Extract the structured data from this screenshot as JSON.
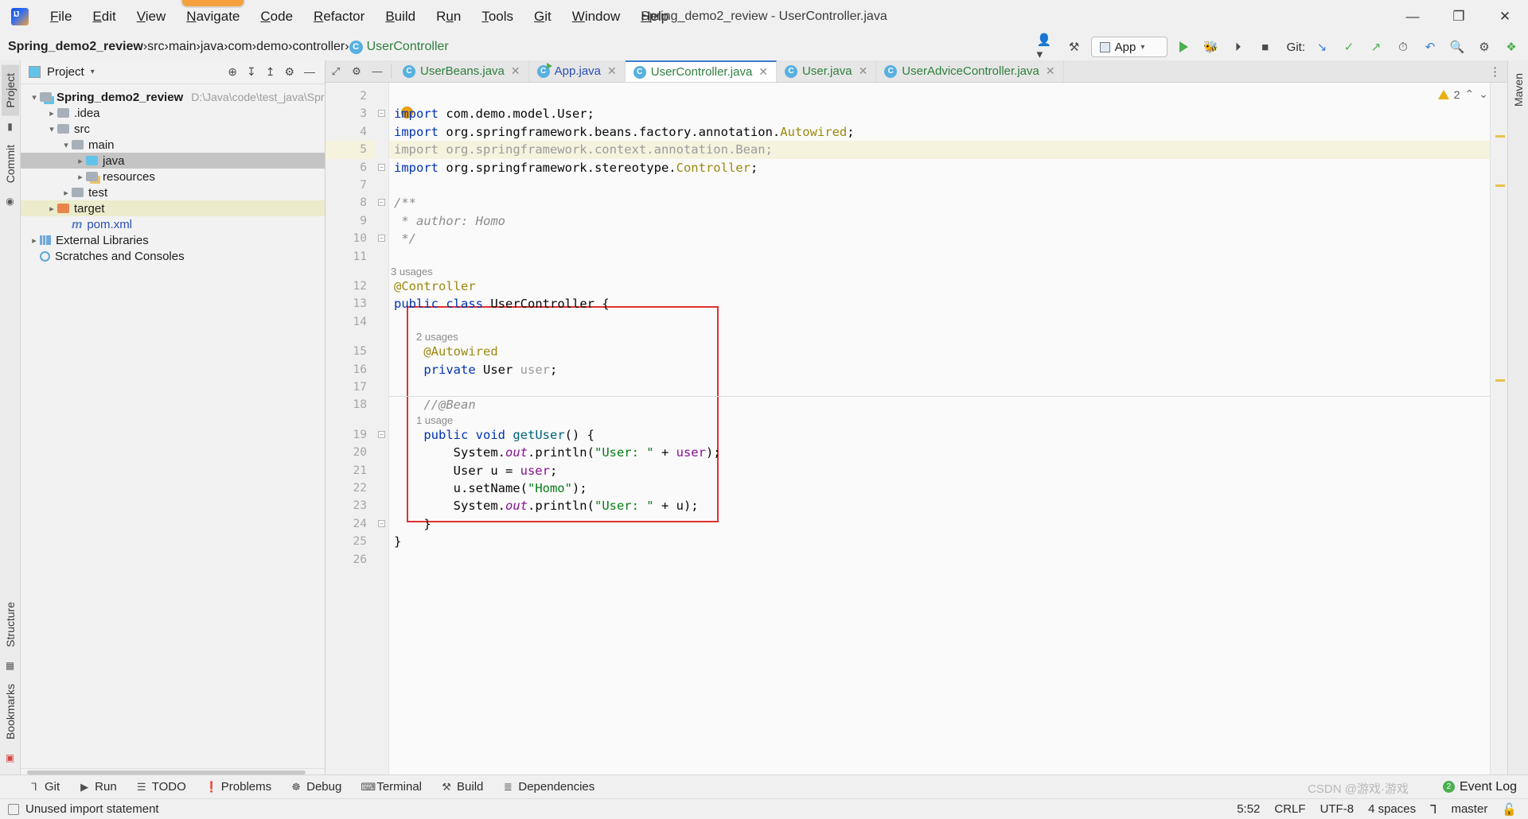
{
  "window": {
    "title": "Spring_demo2_review - UserController.java",
    "app_icon": "intellij-idea-logo",
    "minimize": "—",
    "maximize": "❐",
    "close": "✕"
  },
  "menu": {
    "items": [
      {
        "label": "File",
        "mnemonic": "F"
      },
      {
        "label": "Edit",
        "mnemonic": "E"
      },
      {
        "label": "View",
        "mnemonic": "V"
      },
      {
        "label": "Navigate",
        "mnemonic": "N",
        "highlighted": true
      },
      {
        "label": "Code",
        "mnemonic": "C"
      },
      {
        "label": "Refactor",
        "mnemonic": "R"
      },
      {
        "label": "Build",
        "mnemonic": "B"
      },
      {
        "label": "Run",
        "mnemonic": "u"
      },
      {
        "label": "Tools",
        "mnemonic": "T"
      },
      {
        "label": "Git",
        "mnemonic": "G"
      },
      {
        "label": "Window",
        "mnemonic": "W"
      },
      {
        "label": "Help",
        "mnemonic": "H"
      }
    ]
  },
  "navbar": {
    "crumbs": [
      "Spring_demo2_review",
      "src",
      "main",
      "java",
      "com",
      "demo",
      "controller"
    ],
    "final_crumb": "UserController",
    "final_crumb_icon": "class-icon",
    "separator": "›",
    "right": {
      "profile_icon": "user-account-icon",
      "hammer_icon": "build-hammer-icon",
      "run_config": "App",
      "run_icon": "run-play-icon",
      "debug_icon": "debug-bug-icon",
      "coverage_icon": "run-with-coverage-icon",
      "stop_icon": "stop-icon",
      "git_label": "Git:",
      "git_update_icon": "git-update-icon",
      "git_commit_icon": "git-commit-check-icon",
      "git_push_icon": "git-push-icon",
      "history_icon": "history-icon",
      "undo_icon": "undo-icon",
      "search_icon": "search-icon",
      "settings_icon": "gear-icon",
      "ide_icon": "ide-update-icon"
    }
  },
  "left_rail": {
    "tabs": [
      "Project",
      "Commit"
    ],
    "bottom_tabs": [
      "Structure",
      "Bookmarks"
    ],
    "active": "Project"
  },
  "right_rail": {
    "tabs": [
      "Maven"
    ]
  },
  "project_panel": {
    "title": "Project",
    "title_icon": "project-view-icon",
    "dropdown_icon": "chevron-down-icon",
    "actions": [
      {
        "name": "select-opened-file-icon",
        "glyph": "⊕"
      },
      {
        "name": "expand-all-icon",
        "glyph": "↧"
      },
      {
        "name": "collapse-all-icon",
        "glyph": "↥"
      },
      {
        "name": "settings-icon",
        "glyph": "⚙"
      },
      {
        "name": "hide-icon",
        "glyph": "—"
      }
    ],
    "tree": [
      {
        "label": "Spring_demo2_review",
        "path": "D:\\Java\\code\\test_java\\Spring_deme",
        "depth": 0,
        "arrow": "expanded",
        "icon": "module-folder",
        "bold": true
      },
      {
        "label": ".idea",
        "depth": 1,
        "arrow": "collapsed",
        "icon": "folder"
      },
      {
        "label": "src",
        "depth": 1,
        "arrow": "expanded",
        "icon": "folder"
      },
      {
        "label": "main",
        "depth": 2,
        "arrow": "expanded",
        "icon": "folder"
      },
      {
        "label": "java",
        "depth": 3,
        "arrow": "collapsed",
        "icon": "source-folder",
        "selected": true
      },
      {
        "label": "resources",
        "depth": 3,
        "arrow": "collapsed",
        "icon": "resource-folder"
      },
      {
        "label": "test",
        "depth": 2,
        "arrow": "collapsed",
        "icon": "folder"
      },
      {
        "label": "target",
        "depth": 1,
        "arrow": "collapsed",
        "icon": "excluded-folder",
        "highlighted": true
      },
      {
        "label": "pom.xml",
        "depth": 2,
        "arrow": "none",
        "icon": "maven-icon"
      },
      {
        "label": "External Libraries",
        "depth": 0,
        "arrow": "collapsed",
        "icon": "libraries-icon"
      },
      {
        "label": "Scratches and Consoles",
        "depth": 0,
        "arrow": "none",
        "icon": "scratches-icon"
      }
    ]
  },
  "editor": {
    "tab_icons": [
      {
        "name": "collapse-icon",
        "glyph": "⤢"
      },
      {
        "name": "gear-icon",
        "glyph": "⚙"
      },
      {
        "name": "hide-icon",
        "glyph": "—"
      }
    ],
    "tabs": [
      {
        "label": "UserBeans.java",
        "icon": "class-icon",
        "active": false,
        "color": "green"
      },
      {
        "label": "App.java",
        "icon": "runnable-class-icon",
        "active": false,
        "color": "blue"
      },
      {
        "label": "UserController.java",
        "icon": "class-icon",
        "active": true,
        "color": "green"
      },
      {
        "label": "User.java",
        "icon": "class-icon",
        "active": false,
        "color": "green"
      },
      {
        "label": "UserAdviceController.java",
        "icon": "class-icon",
        "active": false,
        "color": "green"
      }
    ],
    "close_glyph": "✕",
    "more_glyph": "⋮",
    "warning_count": "2",
    "warning_icon": "warning-triangle-icon",
    "inspection_up": "⌃",
    "inspection_down": "⌄",
    "annotation_box": "red-highlight-box",
    "annotation_color": "#e03131"
  },
  "code": {
    "first_visible_line": 2,
    "last_visible_line": 26,
    "hints": [
      {
        "line": 12,
        "text": "3 usages"
      },
      {
        "line": 15,
        "text": "2 usages"
      },
      {
        "line": 19,
        "text": "1 usage"
      }
    ],
    "lines": [
      {
        "n": 2,
        "tokens": []
      },
      {
        "n": 3,
        "tokens": [
          {
            "t": "import",
            "c": "kw"
          },
          {
            "t": " com.demo.model.User;",
            "c": "plain"
          }
        ]
      },
      {
        "n": 4,
        "tokens": [
          {
            "t": "import",
            "c": "kw"
          },
          {
            "t": " org.springframework.beans.factory.annotation.",
            "c": "plain"
          },
          {
            "t": "Autowired",
            "c": "ann"
          },
          {
            "t": ";",
            "c": "plain"
          }
        ]
      },
      {
        "n": 5,
        "tokens": [
          {
            "t": "import",
            "c": "gray"
          },
          {
            "t": " org.springframework.context.annotation.Bean;",
            "c": "gray"
          }
        ],
        "unused": true
      },
      {
        "n": 6,
        "tokens": [
          {
            "t": "import",
            "c": "kw"
          },
          {
            "t": " org.springframework.stereotype.",
            "c": "plain"
          },
          {
            "t": "Controller",
            "c": "ann"
          },
          {
            "t": ";",
            "c": "plain"
          }
        ]
      },
      {
        "n": 7,
        "tokens": []
      },
      {
        "n": 8,
        "tokens": [
          {
            "t": "/**",
            "c": "cmt"
          }
        ]
      },
      {
        "n": 9,
        "tokens": [
          {
            "t": " * author: Homo",
            "c": "cmt"
          }
        ]
      },
      {
        "n": 10,
        "tokens": [
          {
            "t": " */",
            "c": "cmt"
          }
        ]
      },
      {
        "n": 11,
        "tokens": []
      },
      {
        "n": 12,
        "tokens": [
          {
            "t": "@Controller",
            "c": "ann"
          }
        ]
      },
      {
        "n": 13,
        "tokens": [
          {
            "t": "public",
            "c": "kw"
          },
          {
            "t": " ",
            "c": "plain"
          },
          {
            "t": "class",
            "c": "kw"
          },
          {
            "t": " UserController {",
            "c": "plain"
          }
        ]
      },
      {
        "n": 14,
        "tokens": []
      },
      {
        "n": 15,
        "tokens": [
          {
            "t": "    @Autowired",
            "c": "ann"
          }
        ]
      },
      {
        "n": 16,
        "tokens": [
          {
            "t": "    ",
            "c": "plain"
          },
          {
            "t": "private",
            "c": "kw"
          },
          {
            "t": " User ",
            "c": "plain"
          },
          {
            "t": "user",
            "c": "gray"
          },
          {
            "t": ";",
            "c": "plain"
          }
        ]
      },
      {
        "n": 17,
        "tokens": []
      },
      {
        "n": 18,
        "tokens": [
          {
            "t": "    //@Bean",
            "c": "cmt"
          }
        ]
      },
      {
        "n": 19,
        "tokens": [
          {
            "t": "    ",
            "c": "plain"
          },
          {
            "t": "public",
            "c": "kw"
          },
          {
            "t": " ",
            "c": "plain"
          },
          {
            "t": "void",
            "c": "kw"
          },
          {
            "t": " ",
            "c": "plain"
          },
          {
            "t": "getUser",
            "c": "mth"
          },
          {
            "t": "() {",
            "c": "plain"
          }
        ]
      },
      {
        "n": 20,
        "tokens": [
          {
            "t": "        System.",
            "c": "plain"
          },
          {
            "t": "out",
            "c": "sfld"
          },
          {
            "t": ".println(",
            "c": "plain"
          },
          {
            "t": "\"User: \"",
            "c": "str"
          },
          {
            "t": " + ",
            "c": "plain"
          },
          {
            "t": "user",
            "c": "fld"
          },
          {
            "t": ");",
            "c": "plain"
          }
        ]
      },
      {
        "n": 21,
        "tokens": [
          {
            "t": "        User u = ",
            "c": "plain"
          },
          {
            "t": "user",
            "c": "fld"
          },
          {
            "t": ";",
            "c": "plain"
          }
        ]
      },
      {
        "n": 22,
        "tokens": [
          {
            "t": "        u.setName(",
            "c": "plain"
          },
          {
            "t": "\"Homo\"",
            "c": "str"
          },
          {
            "t": ");",
            "c": "plain"
          }
        ]
      },
      {
        "n": 23,
        "tokens": [
          {
            "t": "        System.",
            "c": "plain"
          },
          {
            "t": "out",
            "c": "sfld"
          },
          {
            "t": ".println(",
            "c": "plain"
          },
          {
            "t": "\"User: \"",
            "c": "str"
          },
          {
            "t": " + u);",
            "c": "plain"
          }
        ]
      },
      {
        "n": 24,
        "tokens": [
          {
            "t": "    }",
            "c": "plain"
          }
        ]
      },
      {
        "n": 25,
        "tokens": [
          {
            "t": "}",
            "c": "plain"
          }
        ]
      },
      {
        "n": 26,
        "tokens": []
      }
    ]
  },
  "bottom_toolwindows": [
    {
      "label": "Git",
      "icon": "git-branch-icon",
      "glyph": "⑂"
    },
    {
      "label": "Run",
      "icon": "run-play-icon",
      "glyph": "▶"
    },
    {
      "label": "TODO",
      "icon": "todo-list-icon",
      "glyph": "☰"
    },
    {
      "label": "Problems",
      "icon": "problems-icon",
      "glyph": "❗"
    },
    {
      "label": "Debug",
      "icon": "debug-bug-icon",
      "glyph": "☸"
    },
    {
      "label": "Terminal",
      "icon": "terminal-icon",
      "glyph": "⌨"
    },
    {
      "label": "Build",
      "icon": "build-hammer-icon",
      "glyph": "⚒"
    },
    {
      "label": "Dependencies",
      "icon": "dependencies-icon",
      "glyph": "≣"
    }
  ],
  "event_log": {
    "label": "Event Log",
    "count": "2"
  },
  "statusbar": {
    "icon": "memory-indicator-icon",
    "message": "Unused import statement",
    "caret": "5:52",
    "line_separator": "CRLF",
    "encoding": "UTF-8",
    "indent": "4 spaces",
    "branch_icon": "git-branch-icon",
    "branch": "master",
    "lock_icon": "read-only-icon"
  },
  "watermark": "CSDN @游戏·游戏"
}
